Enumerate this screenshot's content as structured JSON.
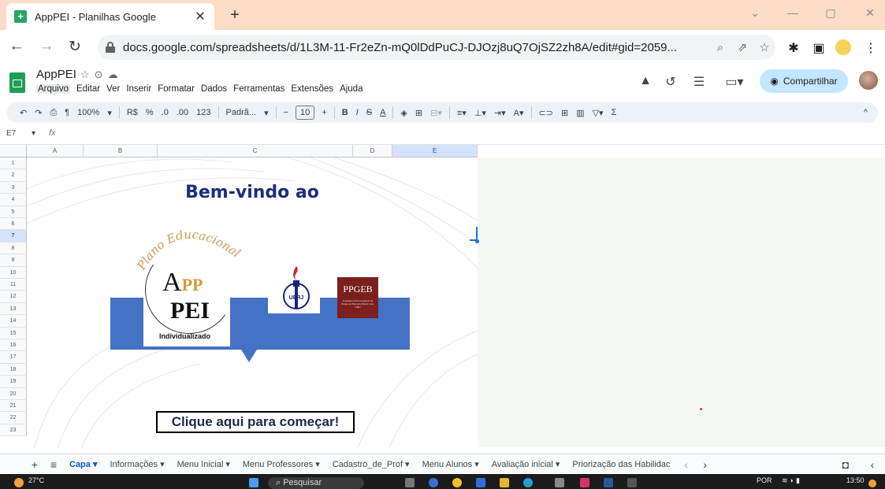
{
  "browser": {
    "tab_title": "AppPEI - Planilhas Google",
    "tab_close": "✕",
    "new_tab": "+",
    "url": "docs.google.com/spreadsheets/d/1L3M-11-Fr2eZn-mQ0lDdPuCJ-DJOzj8uQ7OjSZ2zh8A/edit#gid=2059..."
  },
  "sheets": {
    "doc_title": "AppPEI",
    "menus": [
      "Arquivo",
      "Editar",
      "Ver",
      "Inserir",
      "Formatar",
      "Dados",
      "Ferramentas",
      "Extensões",
      "Ajuda"
    ],
    "share_label": "Compartilhar",
    "toolbar": {
      "zoom": "100%",
      "currency": "R$",
      "percent": "%",
      "dec_less": ".0",
      "dec_more": ".00",
      "num_format": "123",
      "font": "Padrã...",
      "font_size": "10",
      "bold": "B",
      "italic": "I",
      "strike": "S",
      "text_color": "A",
      "sigma": "Σ"
    },
    "cell_ref": "E7",
    "fx": "fx",
    "columns": [
      "A",
      "B",
      "C",
      "D",
      "E"
    ],
    "selected_column": "E",
    "selected_row": 7,
    "rows": [
      "1",
      "2",
      "3",
      "4",
      "5",
      "6",
      "7",
      "8",
      "9",
      "10",
      "11",
      "12",
      "13",
      "14",
      "15",
      "16",
      "17",
      "18",
      "19",
      "20",
      "21",
      "22",
      "23"
    ]
  },
  "banner": {
    "welcome": "Bem-vindo ao",
    "logo_arc": "Plano Educacional",
    "logo_a": "A",
    "logo_pp": "PP",
    "logo_pei": "PEI",
    "logo_individualizado": "Individualizado",
    "uerj": "UERJ",
    "ppgeb": "PPGEB",
    "ppgeb_sub": "Programa de Pós-Graduação de Ensino em Educação Básica CAp-UERJ",
    "cta": "Clique aqui para começar!"
  },
  "sheet_tabs": [
    {
      "label": "Capa",
      "active": true
    },
    {
      "label": "Informações",
      "active": false
    },
    {
      "label": "Menu Inicial",
      "active": false
    },
    {
      "label": "Menu Professores",
      "active": false
    },
    {
      "label": "Cadastro_de_Prof",
      "active": false
    },
    {
      "label": "Menu Alunos",
      "active": false
    },
    {
      "label": "Avaliação inicial",
      "active": false
    },
    {
      "label": "Priorização das Habilidac",
      "active": false
    }
  ],
  "taskbar": {
    "temp": "27°C",
    "search": "Pesquisar",
    "lang": "POR",
    "time": "13:50"
  },
  "colors": {
    "sheets_green": "#1e9d56",
    "banner_blue": "#4472c4",
    "title_navy": "#1b2e7a",
    "ppgeb_red": "#7b1f1f"
  }
}
